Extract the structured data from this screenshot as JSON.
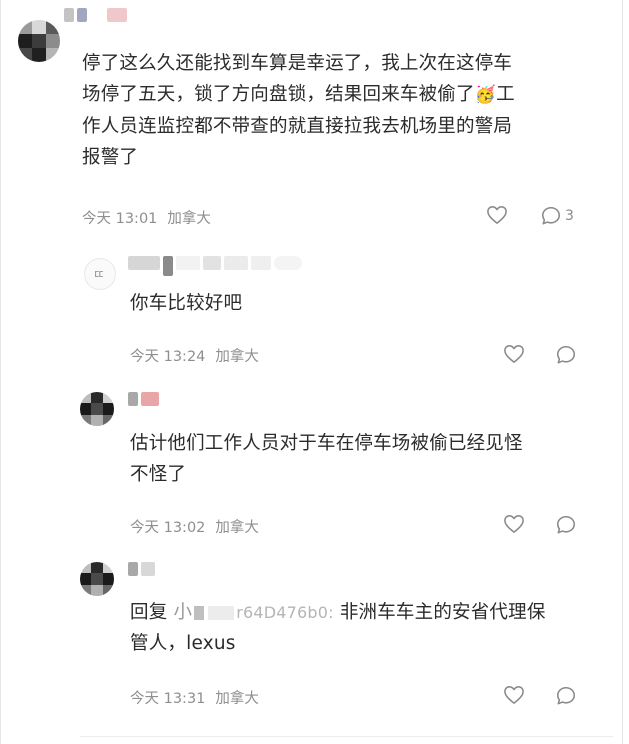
{
  "colors": {
    "text_primary": "#2b2b2b",
    "text_meta": "#8f8f8f",
    "icon": "#8a8a8a"
  },
  "comments": [
    {
      "text": "停了这么久还能找到车算是幸运了，我上次在这停车场停了五天，锁了方向盘锁，结果回来车被偷了🥳工作人员连监控都不带查的就直接拉我去机场里的警局报警了",
      "line1": "停了这么久还能找到车算是幸运了，我上次在这停车",
      "line2": "场停了五天，锁了方向盘锁，结果回来车被偷了",
      "line2_tail": "工",
      "line3": "作人员连监控都不带查的就直接拉我去机场里的警局",
      "line4": "报警了",
      "emoji": "🥳",
      "time": "今天 13:01",
      "location": "加拿大",
      "comment_count": "3"
    }
  ],
  "replies": [
    {
      "text": "你车比较好吧",
      "time": "今天 13:24",
      "location": "加拿大"
    },
    {
      "line1": "估计他们工作人员对于车在停车场被偷已经见怪",
      "line2": "不怪了",
      "time": "今天 13:02",
      "location": "加拿大"
    },
    {
      "line1_prefix": "回复",
      "line1_partial_a": "小",
      "line1_partial_b": "r64D476b0:",
      "line1_body": "非洲车车主的安省代理保",
      "line2": "管人，lexus",
      "time": "今天 13:31",
      "location": "加拿大"
    }
  ]
}
